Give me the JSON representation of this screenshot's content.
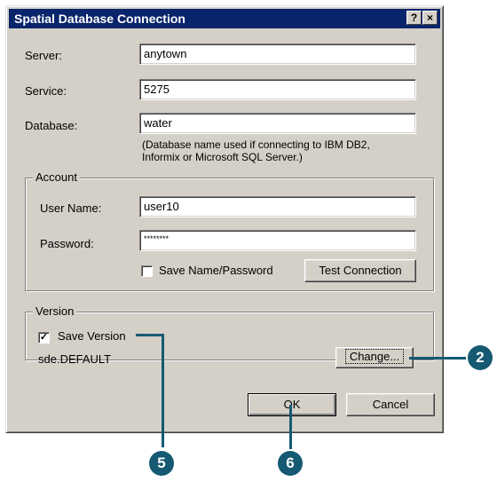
{
  "dialog": {
    "title": "Spatial Database Connection",
    "help_glyph": "?",
    "close_glyph": "×"
  },
  "connection": {
    "server_label": "Server:",
    "server_value": "anytown",
    "service_label": "Service:",
    "service_value": "5275",
    "database_label": "Database:",
    "database_value": "water",
    "database_note_line1": "(Database name used if connecting to IBM DB2,",
    "database_note_line2": "Informix or Microsoft SQL Server.)"
  },
  "account": {
    "legend": "Account",
    "username_label": "User Name:",
    "username_value": "user10",
    "password_label": "Password:",
    "password_value": "********",
    "save_label": "Save Name/Password",
    "save_checked": false,
    "test_button": "Test Connection"
  },
  "version": {
    "legend": "Version",
    "save_label": "Save Version",
    "save_checked": true,
    "check_glyph": "✓",
    "current_version": "sde.DEFAULT",
    "change_button": "Change..."
  },
  "buttons": {
    "ok": "OK",
    "cancel": "Cancel"
  },
  "callouts": {
    "change": "2",
    "save_version": "5",
    "ok": "6"
  },
  "colors": {
    "title_bar": "#08246b",
    "dialog_face": "#d4d0c8",
    "callout": "#155a72"
  }
}
